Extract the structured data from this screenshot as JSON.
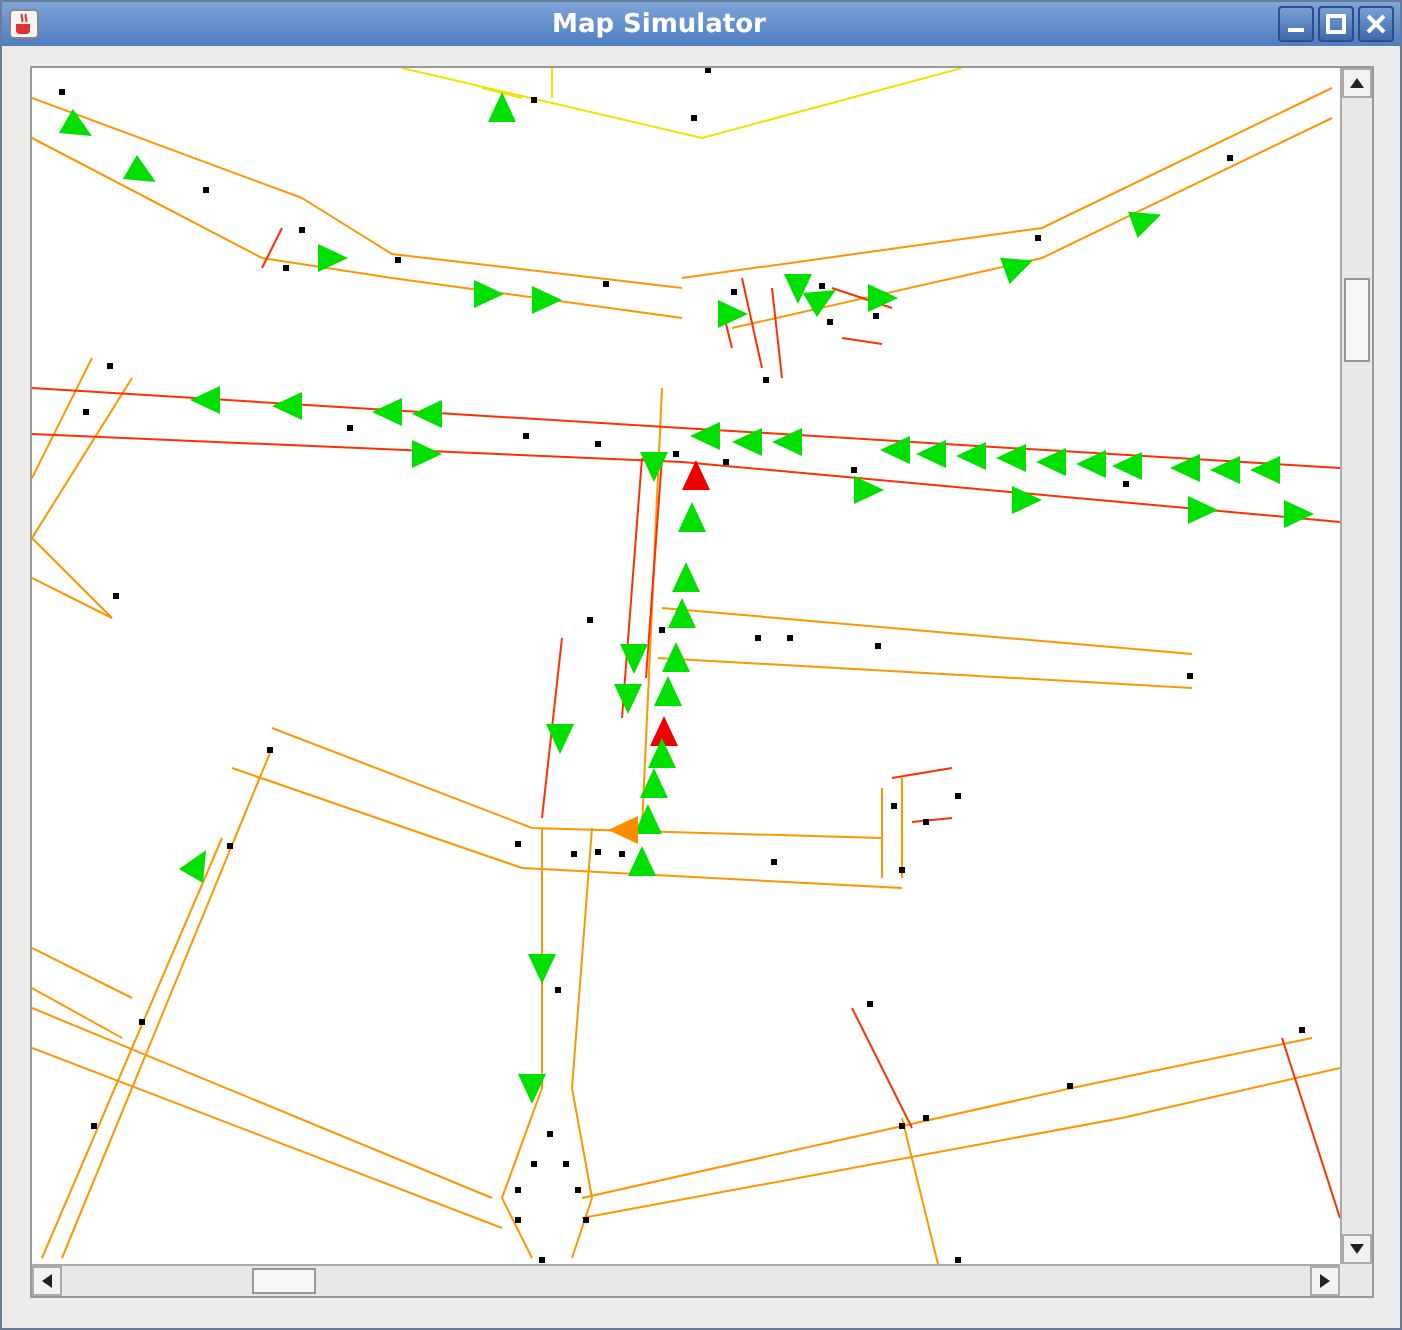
{
  "window": {
    "title": "Map Simulator"
  }
}
